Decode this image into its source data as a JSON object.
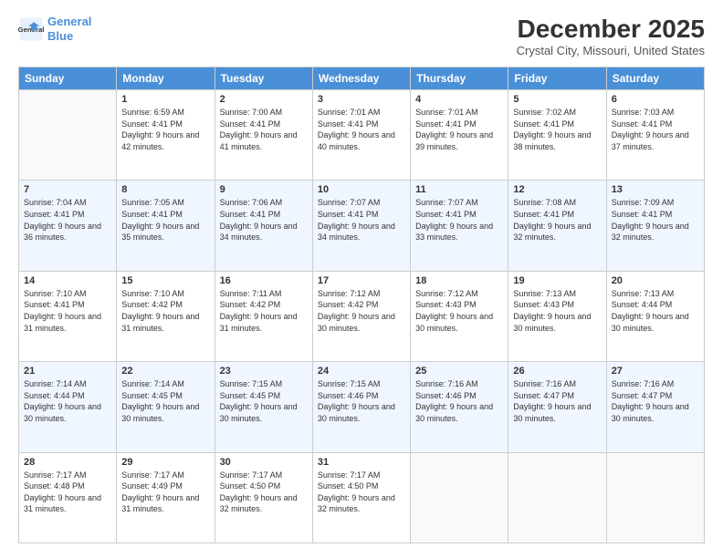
{
  "header": {
    "logo_line1": "General",
    "logo_line2": "Blue",
    "month": "December 2025",
    "location": "Crystal City, Missouri, United States"
  },
  "days_of_week": [
    "Sunday",
    "Monday",
    "Tuesday",
    "Wednesday",
    "Thursday",
    "Friday",
    "Saturday"
  ],
  "weeks": [
    [
      {
        "day": "",
        "sunrise": "",
        "sunset": "",
        "daylight": ""
      },
      {
        "day": "1",
        "sunrise": "Sunrise: 6:59 AM",
        "sunset": "Sunset: 4:41 PM",
        "daylight": "Daylight: 9 hours and 42 minutes."
      },
      {
        "day": "2",
        "sunrise": "Sunrise: 7:00 AM",
        "sunset": "Sunset: 4:41 PM",
        "daylight": "Daylight: 9 hours and 41 minutes."
      },
      {
        "day": "3",
        "sunrise": "Sunrise: 7:01 AM",
        "sunset": "Sunset: 4:41 PM",
        "daylight": "Daylight: 9 hours and 40 minutes."
      },
      {
        "day": "4",
        "sunrise": "Sunrise: 7:01 AM",
        "sunset": "Sunset: 4:41 PM",
        "daylight": "Daylight: 9 hours and 39 minutes."
      },
      {
        "day": "5",
        "sunrise": "Sunrise: 7:02 AM",
        "sunset": "Sunset: 4:41 PM",
        "daylight": "Daylight: 9 hours and 38 minutes."
      },
      {
        "day": "6",
        "sunrise": "Sunrise: 7:03 AM",
        "sunset": "Sunset: 4:41 PM",
        "daylight": "Daylight: 9 hours and 37 minutes."
      }
    ],
    [
      {
        "day": "7",
        "sunrise": "Sunrise: 7:04 AM",
        "sunset": "Sunset: 4:41 PM",
        "daylight": "Daylight: 9 hours and 36 minutes."
      },
      {
        "day": "8",
        "sunrise": "Sunrise: 7:05 AM",
        "sunset": "Sunset: 4:41 PM",
        "daylight": "Daylight: 9 hours and 35 minutes."
      },
      {
        "day": "9",
        "sunrise": "Sunrise: 7:06 AM",
        "sunset": "Sunset: 4:41 PM",
        "daylight": "Daylight: 9 hours and 34 minutes."
      },
      {
        "day": "10",
        "sunrise": "Sunrise: 7:07 AM",
        "sunset": "Sunset: 4:41 PM",
        "daylight": "Daylight: 9 hours and 34 minutes."
      },
      {
        "day": "11",
        "sunrise": "Sunrise: 7:07 AM",
        "sunset": "Sunset: 4:41 PM",
        "daylight": "Daylight: 9 hours and 33 minutes."
      },
      {
        "day": "12",
        "sunrise": "Sunrise: 7:08 AM",
        "sunset": "Sunset: 4:41 PM",
        "daylight": "Daylight: 9 hours and 32 minutes."
      },
      {
        "day": "13",
        "sunrise": "Sunrise: 7:09 AM",
        "sunset": "Sunset: 4:41 PM",
        "daylight": "Daylight: 9 hours and 32 minutes."
      }
    ],
    [
      {
        "day": "14",
        "sunrise": "Sunrise: 7:10 AM",
        "sunset": "Sunset: 4:41 PM",
        "daylight": "Daylight: 9 hours and 31 minutes."
      },
      {
        "day": "15",
        "sunrise": "Sunrise: 7:10 AM",
        "sunset": "Sunset: 4:42 PM",
        "daylight": "Daylight: 9 hours and 31 minutes."
      },
      {
        "day": "16",
        "sunrise": "Sunrise: 7:11 AM",
        "sunset": "Sunset: 4:42 PM",
        "daylight": "Daylight: 9 hours and 31 minutes."
      },
      {
        "day": "17",
        "sunrise": "Sunrise: 7:12 AM",
        "sunset": "Sunset: 4:42 PM",
        "daylight": "Daylight: 9 hours and 30 minutes."
      },
      {
        "day": "18",
        "sunrise": "Sunrise: 7:12 AM",
        "sunset": "Sunset: 4:43 PM",
        "daylight": "Daylight: 9 hours and 30 minutes."
      },
      {
        "day": "19",
        "sunrise": "Sunrise: 7:13 AM",
        "sunset": "Sunset: 4:43 PM",
        "daylight": "Daylight: 9 hours and 30 minutes."
      },
      {
        "day": "20",
        "sunrise": "Sunrise: 7:13 AM",
        "sunset": "Sunset: 4:44 PM",
        "daylight": "Daylight: 9 hours and 30 minutes."
      }
    ],
    [
      {
        "day": "21",
        "sunrise": "Sunrise: 7:14 AM",
        "sunset": "Sunset: 4:44 PM",
        "daylight": "Daylight: 9 hours and 30 minutes."
      },
      {
        "day": "22",
        "sunrise": "Sunrise: 7:14 AM",
        "sunset": "Sunset: 4:45 PM",
        "daylight": "Daylight: 9 hours and 30 minutes."
      },
      {
        "day": "23",
        "sunrise": "Sunrise: 7:15 AM",
        "sunset": "Sunset: 4:45 PM",
        "daylight": "Daylight: 9 hours and 30 minutes."
      },
      {
        "day": "24",
        "sunrise": "Sunrise: 7:15 AM",
        "sunset": "Sunset: 4:46 PM",
        "daylight": "Daylight: 9 hours and 30 minutes."
      },
      {
        "day": "25",
        "sunrise": "Sunrise: 7:16 AM",
        "sunset": "Sunset: 4:46 PM",
        "daylight": "Daylight: 9 hours and 30 minutes."
      },
      {
        "day": "26",
        "sunrise": "Sunrise: 7:16 AM",
        "sunset": "Sunset: 4:47 PM",
        "daylight": "Daylight: 9 hours and 30 minutes."
      },
      {
        "day": "27",
        "sunrise": "Sunrise: 7:16 AM",
        "sunset": "Sunset: 4:47 PM",
        "daylight": "Daylight: 9 hours and 30 minutes."
      }
    ],
    [
      {
        "day": "28",
        "sunrise": "Sunrise: 7:17 AM",
        "sunset": "Sunset: 4:48 PM",
        "daylight": "Daylight: 9 hours and 31 minutes."
      },
      {
        "day": "29",
        "sunrise": "Sunrise: 7:17 AM",
        "sunset": "Sunset: 4:49 PM",
        "daylight": "Daylight: 9 hours and 31 minutes."
      },
      {
        "day": "30",
        "sunrise": "Sunrise: 7:17 AM",
        "sunset": "Sunset: 4:50 PM",
        "daylight": "Daylight: 9 hours and 32 minutes."
      },
      {
        "day": "31",
        "sunrise": "Sunrise: 7:17 AM",
        "sunset": "Sunset: 4:50 PM",
        "daylight": "Daylight: 9 hours and 32 minutes."
      },
      {
        "day": "",
        "sunrise": "",
        "sunset": "",
        "daylight": ""
      },
      {
        "day": "",
        "sunrise": "",
        "sunset": "",
        "daylight": ""
      },
      {
        "day": "",
        "sunrise": "",
        "sunset": "",
        "daylight": ""
      }
    ]
  ]
}
